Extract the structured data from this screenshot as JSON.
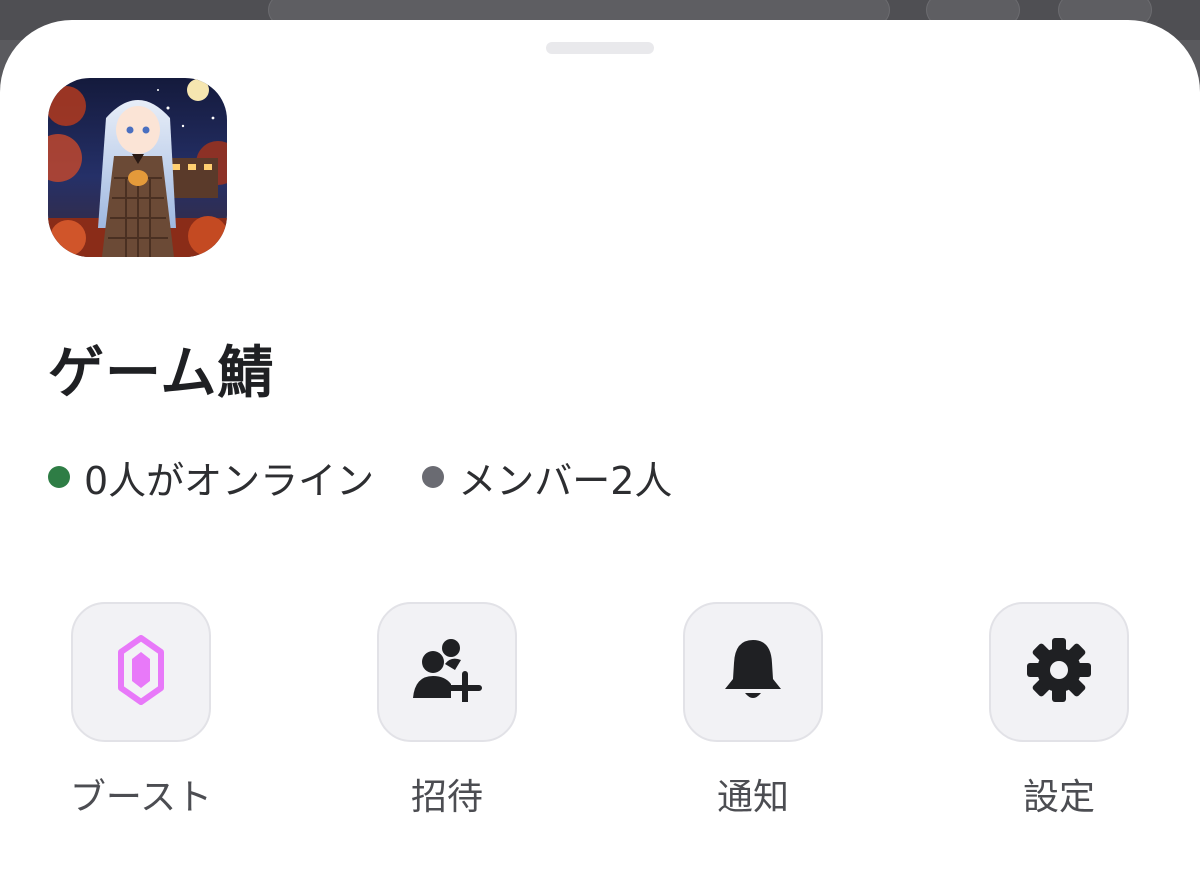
{
  "server": {
    "name": "ゲーム鯖",
    "online_text": "0人がオンライン",
    "members_text": "メンバー2人"
  },
  "status_colors": {
    "online": "#2e7d45",
    "members": "#6a6b72"
  },
  "actions": [
    {
      "label": "ブースト",
      "icon": "boost-gem-icon",
      "color": "#e879f9"
    },
    {
      "label": "招待",
      "icon": "invite-person-add-icon",
      "color": "#1f2023"
    },
    {
      "label": "通知",
      "icon": "bell-icon",
      "color": "#1f2023"
    },
    {
      "label": "設定",
      "icon": "gear-icon",
      "color": "#1f2023"
    }
  ]
}
